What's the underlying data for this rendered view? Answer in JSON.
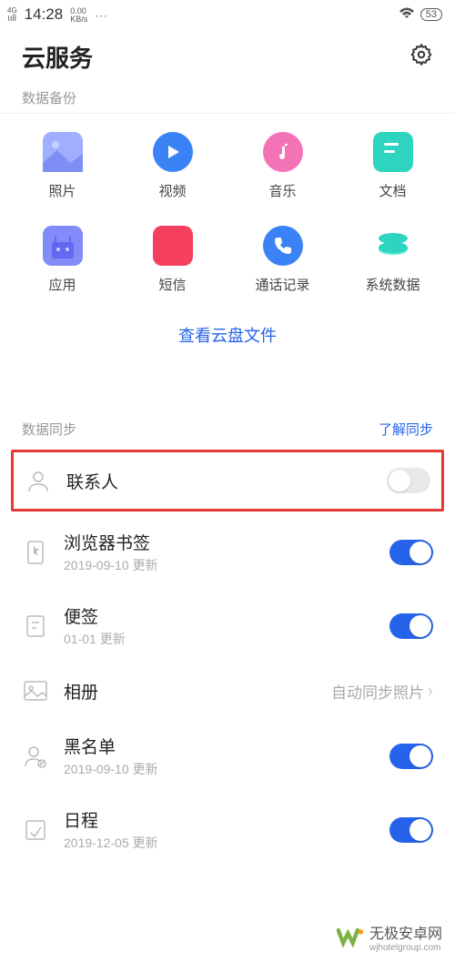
{
  "status_bar": {
    "network": "4G",
    "time": "14:28",
    "speed_value": "0.00",
    "speed_unit": "KB/s",
    "battery": "53"
  },
  "header": {
    "title": "云服务"
  },
  "backup": {
    "section_title": "数据备份",
    "items": [
      {
        "label": "照片"
      },
      {
        "label": "视频"
      },
      {
        "label": "音乐"
      },
      {
        "label": "文档"
      },
      {
        "label": "应用"
      },
      {
        "label": "短信"
      },
      {
        "label": "通话记录"
      },
      {
        "label": "系统数据"
      }
    ],
    "view_files": "查看云盘文件"
  },
  "sync": {
    "section_title": "数据同步",
    "learn_more": "了解同步",
    "items": [
      {
        "title": "联系人",
        "sub": "",
        "toggle": "off",
        "action": "",
        "highlight": true
      },
      {
        "title": "浏览器书签",
        "sub": "2019-09-10 更新",
        "toggle": "on"
      },
      {
        "title": "便签",
        "sub": "01-01 更新",
        "toggle": "on"
      },
      {
        "title": "相册",
        "sub": "",
        "action": "自动同步照片"
      },
      {
        "title": "黑名单",
        "sub": "2019-09-10 更新",
        "toggle": "on"
      },
      {
        "title": "日程",
        "sub": "2019-12-05 更新",
        "toggle": "on"
      }
    ]
  },
  "watermark": {
    "text": "无极安卓网",
    "url": "wjhotelgroup.com"
  }
}
